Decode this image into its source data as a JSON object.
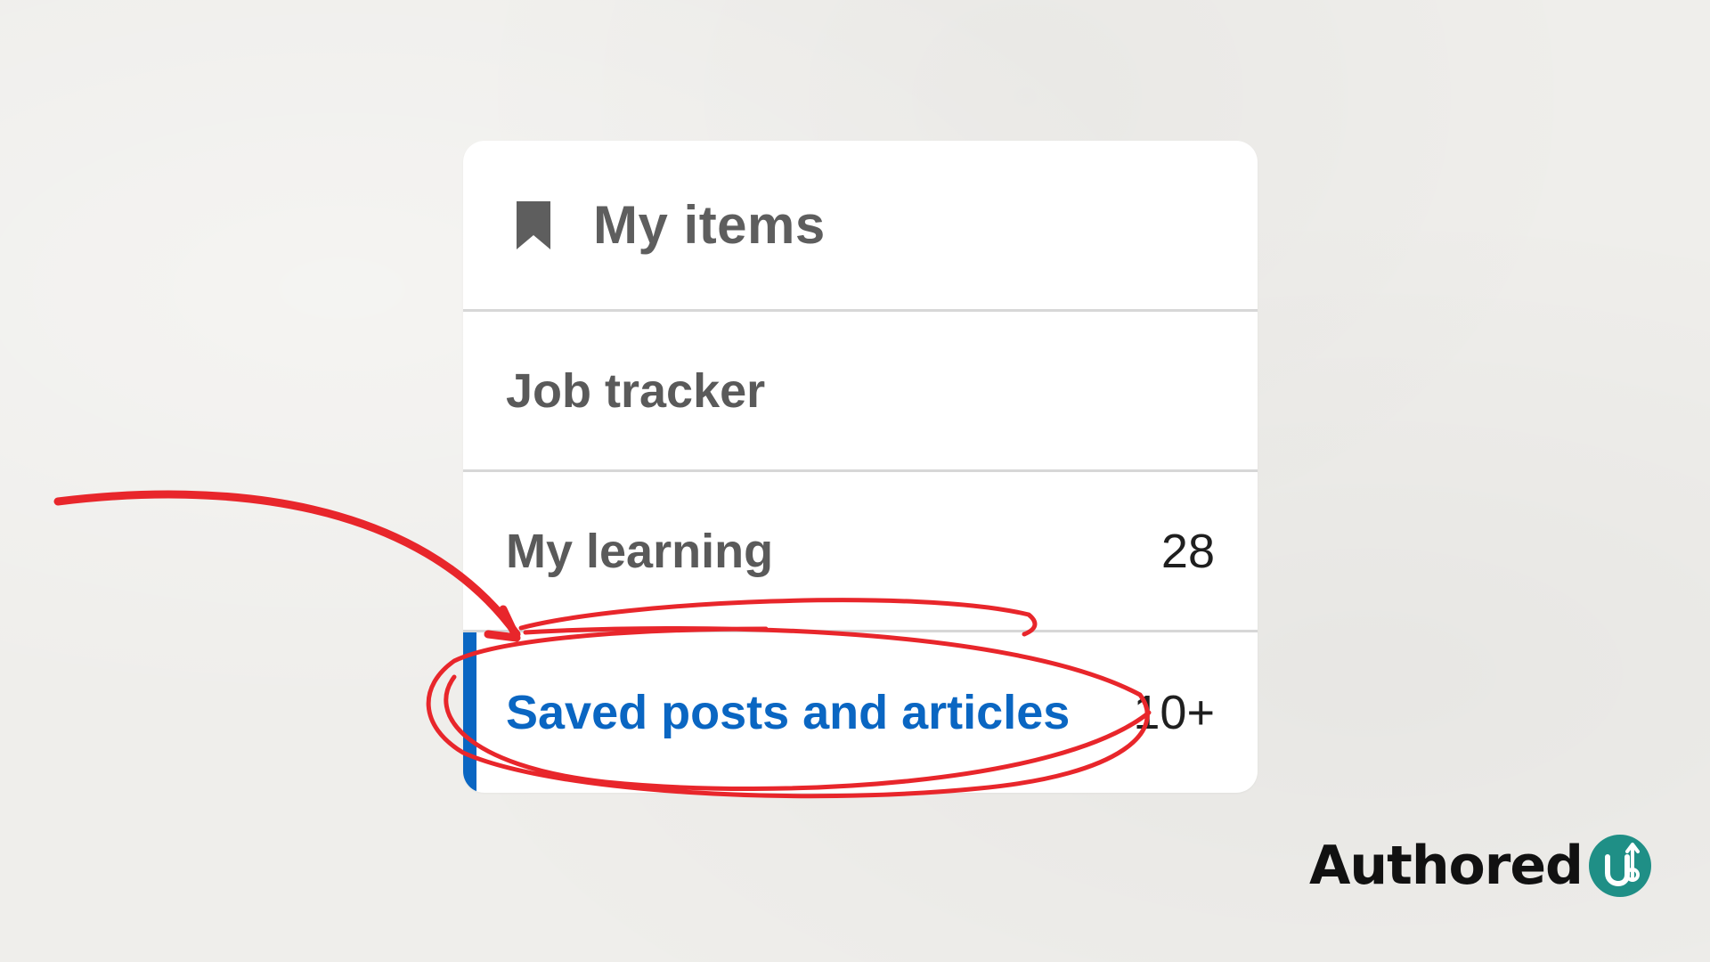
{
  "panel": {
    "title": "My items",
    "title_icon": "bookmark-icon",
    "items": [
      {
        "label": "Job tracker",
        "count": ""
      },
      {
        "label": "My learning",
        "count": "28"
      },
      {
        "label": "Saved posts and articles",
        "count": "10+",
        "active": true
      }
    ]
  },
  "annotation": {
    "type": "red arrow and hand-drawn circle highlighting saved posts and articles",
    "color": "#e8262b"
  },
  "brand": {
    "text": "Authored",
    "badge_text": "up",
    "badge_color": "#1f8f86"
  },
  "colors": {
    "accent": "#0a66c2",
    "background": "#efeeeb"
  }
}
